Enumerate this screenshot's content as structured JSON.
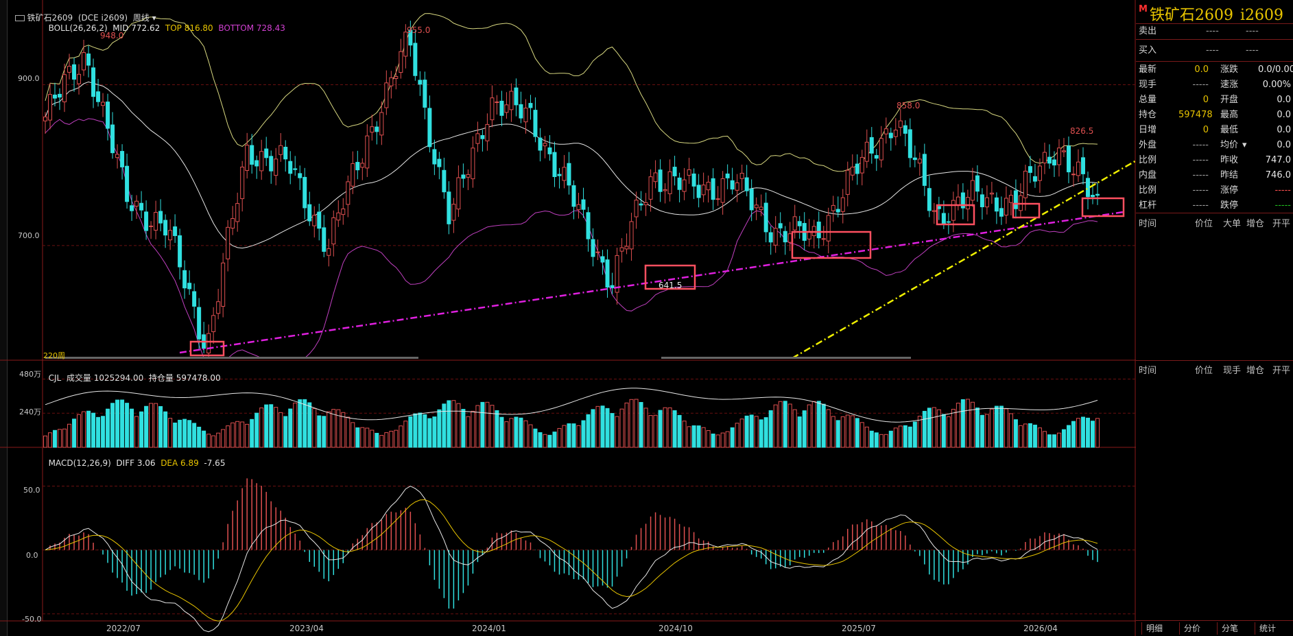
{
  "window": {
    "title_icon": "window-icon",
    "title": "铁矿石2609",
    "code_paren": "(DCE i2609)",
    "period": "周线"
  },
  "boll": {
    "label": "BOLL(26,26,2)",
    "mid": "MID 772.62",
    "top": "TOP 816.80",
    "bottom": "BOTTOM 728.43"
  },
  "price_axis": [
    "900.0",
    "700.0"
  ],
  "period_count": "220周",
  "peaks": [
    "948.0",
    "955.0",
    "858.0",
    "826.5",
    "641.5"
  ],
  "cjl": {
    "label": "CJL",
    "volume": "成交量 1025294.00",
    "oi": "持仓量 597478.00",
    "axis": [
      "480万",
      "240万"
    ]
  },
  "macd": {
    "label": "MACD(12,26,9)",
    "diff": "DIFF 3.06",
    "dea": "DEA 6.89",
    "macd": "-7.65",
    "axis": [
      "50.0",
      "0.0",
      "-50.0"
    ]
  },
  "dates": [
    "2022/07",
    "2023/04",
    "2024/01",
    "2024/10",
    "2025/07",
    "2026/04"
  ],
  "quote": {
    "mark": "M",
    "name": "铁矿石2609",
    "code": "i2609",
    "sell": {
      "label": "卖出",
      "price": "----",
      "vol": "----"
    },
    "buy": {
      "label": "买入",
      "price": "----",
      "vol": "----"
    },
    "rows": [
      {
        "l1": "最新",
        "v1": "0.0",
        "l2": "涨跌",
        "v2": "0.0/0.00%"
      },
      {
        "l1": "现手",
        "v1": "-----",
        "l2": "速涨",
        "v2": "0.00%"
      },
      {
        "l1": "总量",
        "v1": "0",
        "l2": "开盘",
        "v2": "0.0"
      },
      {
        "l1": "持仓",
        "v1": "597478",
        "l2": "最高",
        "v2": "0.0"
      },
      {
        "l1": "日增",
        "v1": "0",
        "l2": "最低",
        "v2": "0.0"
      },
      {
        "l1": "外盘",
        "v1": "-----",
        "l2": "均价",
        "v2": "0.0"
      },
      {
        "l1": "比例",
        "v1": "-----",
        "l2": "昨收",
        "v2": "747.0"
      },
      {
        "l1": "内盘",
        "v1": "-----",
        "l2": "昨结",
        "v2": "746.0"
      },
      {
        "l1": "比例",
        "v1": "-----",
        "l2": "涨停",
        "v2": "-----"
      },
      {
        "l1": "杠杆",
        "v1": "-----",
        "l2": "跌停",
        "v2": "-----"
      }
    ],
    "avg_arrow": "▾",
    "table1_cols": [
      "时间",
      "价位",
      "大单",
      "增仓",
      "开平"
    ],
    "table2_cols": [
      "时间",
      "价位",
      "现手",
      "增仓",
      "开平"
    ],
    "tabs": [
      "明细",
      "分价",
      "分笔",
      "统计"
    ]
  },
  "colors": {
    "up": "#e05050",
    "down": "#30e0e0",
    "boll_outer": "#d8d880",
    "boll_mid": "#e8e8e8",
    "boll_bottom": "#c040c0",
    "support": "#e020e0",
    "trend": "#f0f000",
    "box": "#ff5060"
  },
  "chart_data": {
    "type": "candlestick",
    "title": "铁矿石2609",
    "price_range": [
      560,
      990
    ],
    "price_series_weekly_close_approx": [
      {
        "date": "2022/02",
        "value": 860
      },
      {
        "date": "2022/05",
        "value": 940
      },
      {
        "date": "2022/07",
        "value": 760
      },
      {
        "date": "2022/09",
        "value": 720
      },
      {
        "date": "2022/11",
        "value": 575
      },
      {
        "date": "2023/01",
        "value": 820
      },
      {
        "date": "2023/04",
        "value": 800
      },
      {
        "date": "2023/06",
        "value": 700
      },
      {
        "date": "2023/09",
        "value": 840
      },
      {
        "date": "2023/12",
        "value": 955
      },
      {
        "date": "2024/02",
        "value": 730
      },
      {
        "date": "2024/04",
        "value": 880
      },
      {
        "date": "2024/06",
        "value": 860
      },
      {
        "date": "2024/08",
        "value": 760
      },
      {
        "date": "2024/09",
        "value": 655
      },
      {
        "date": "2024/10",
        "value": 790
      },
      {
        "date": "2024/12",
        "value": 770
      },
      {
        "date": "2025/02",
        "value": 780
      },
      {
        "date": "2025/04",
        "value": 720
      },
      {
        "date": "2025/06",
        "value": 710
      },
      {
        "date": "2025/08",
        "value": 790
      },
      {
        "date": "2025/10",
        "value": 858
      },
      {
        "date": "2025/12",
        "value": 740
      },
      {
        "date": "2026/02",
        "value": 760
      },
      {
        "date": "2026/04",
        "value": 755
      },
      {
        "date": "2026/06",
        "value": 826.5
      },
      {
        "date": "2026/08",
        "value": 747
      }
    ],
    "boll": {
      "mid": 772.62,
      "top": 816.8,
      "bottom": 728.43
    },
    "volume_range": [
      0,
      5400000
    ],
    "volume_last": 1025294.0,
    "open_interest_last": 597478.0,
    "macd_range": [
      -55,
      75
    ],
    "macd_last": {
      "diff": 3.06,
      "dea": 6.89,
      "macd": -7.65
    },
    "annotations": [
      "948.0",
      "955.0",
      "858.0",
      "826.5",
      "641.5"
    ]
  }
}
